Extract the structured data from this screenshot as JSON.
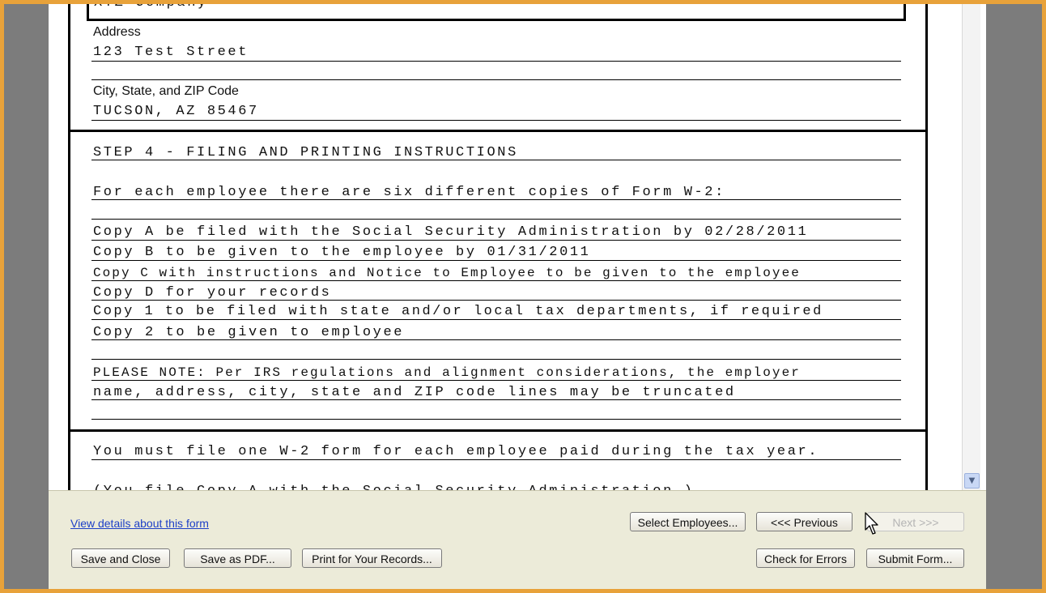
{
  "form": {
    "company_name": "XYZ Company",
    "address_label": "Address",
    "address_value": "123 Test Street",
    "city_label": "City, State, and ZIP Code",
    "city_value": "TUCSON, AZ 85467"
  },
  "instructions": {
    "step_heading": "STEP 4 - FILING AND PRINTING INSTRUCTIONS",
    "intro": "For each employee there are six different copies of Form W-2:",
    "copies": [
      "Copy A be filed with the Social Security Administration by 02/28/2011",
      "Copy B to be given to the employee by 01/31/2011",
      "Copy C with instructions and Notice to Employee to be given to the employee",
      "Copy D for your records",
      "Copy 1 to be filed with state and/or local tax departments, if required",
      "Copy 2 to be given to employee"
    ],
    "note_line1": "PLEASE NOTE: Per IRS regulations and alignment considerations, the employer",
    "note_line2": "name, address, city, state and ZIP code lines may be truncated"
  },
  "footer_text": {
    "line1": "You must file one W-2 form for each employee paid during the tax year.",
    "line2": "(You file Copy A with the Social Security Administration.)"
  },
  "bottom_panel": {
    "details_link": "View details about this form",
    "select_employees": "Select Employees...",
    "previous": "<<<  Previous",
    "next": "Next  >>>",
    "save_close": "Save and Close",
    "save_pdf": "Save as PDF...",
    "print_records": "Print for Your Records...",
    "check_errors": "Check for Errors",
    "submit_form": "Submit Form..."
  },
  "icons": {
    "scroll_down": "chevron-down-icon",
    "cursor": "mouse-pointer-icon"
  },
  "colors": {
    "frame": "#e8a23a",
    "panel": "#ecebd9",
    "link": "#1d3fc7"
  }
}
